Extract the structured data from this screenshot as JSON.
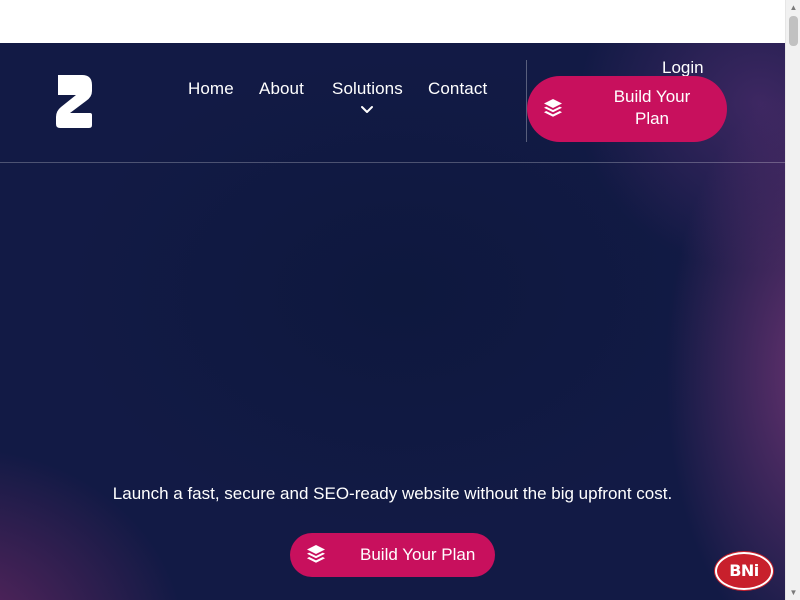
{
  "header": {
    "nav": {
      "home": "Home",
      "about": "About",
      "solutions": "Solutions",
      "contact": "Contact"
    },
    "login": "Login",
    "cta_label": "Build Your Plan",
    "logo_icon": "z-logo-icon",
    "dropdown_icon": "chevron-down-icon"
  },
  "hero": {
    "tagline": "Launch a fast, secure and SEO-ready website without the big upfront cost.",
    "cta_label": "Build Your Plan",
    "cta_icon": "layers-icon"
  },
  "badge": {
    "text": "BNi"
  },
  "scrollbar": {
    "up": "▲",
    "down": "▼"
  },
  "colors": {
    "accent": "#c8105d",
    "hero_bg": "#121a45",
    "badge_red": "#c8202c"
  }
}
